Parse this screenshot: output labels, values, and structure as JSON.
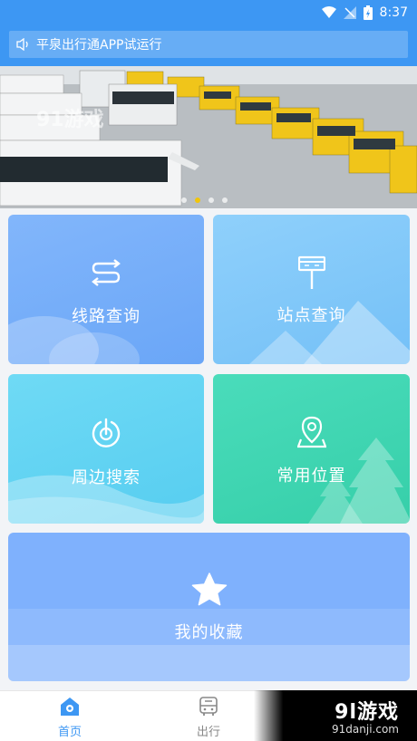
{
  "status_bar": {
    "time": "8:37",
    "icons": [
      "wifi-icon",
      "signal-icon",
      "battery-icon"
    ]
  },
  "notice": {
    "text": "平泉出行通APP试运行",
    "icon": "speaker-icon"
  },
  "banner": {
    "slides": 4,
    "active_index": 1,
    "watermark": "91游戏"
  },
  "menu": {
    "route": {
      "label": "线路查询",
      "icon": "route-icon"
    },
    "station": {
      "label": "站点查询",
      "icon": "station-sign-icon"
    },
    "nearby": {
      "label": "周边搜索",
      "icon": "nearby-radar-icon"
    },
    "favorite_places": {
      "label": "常用位置",
      "icon": "location-pin-icon"
    },
    "collection": {
      "label": "我的收藏",
      "icon": "star-icon"
    }
  },
  "tabs": [
    {
      "label": "首页",
      "icon": "home-icon",
      "active": true
    },
    {
      "label": "出行",
      "icon": "bus-icon",
      "active": false
    }
  ],
  "watermark": {
    "logo": "9l游戏",
    "url": "91danji.com"
  },
  "colors": {
    "primary": "#3d97f3",
    "route": "#7ab0fa",
    "station": "#84c8f9",
    "nearby": "#63d4f3",
    "places": "#40d6b3",
    "collection": "#7fb1fd"
  }
}
